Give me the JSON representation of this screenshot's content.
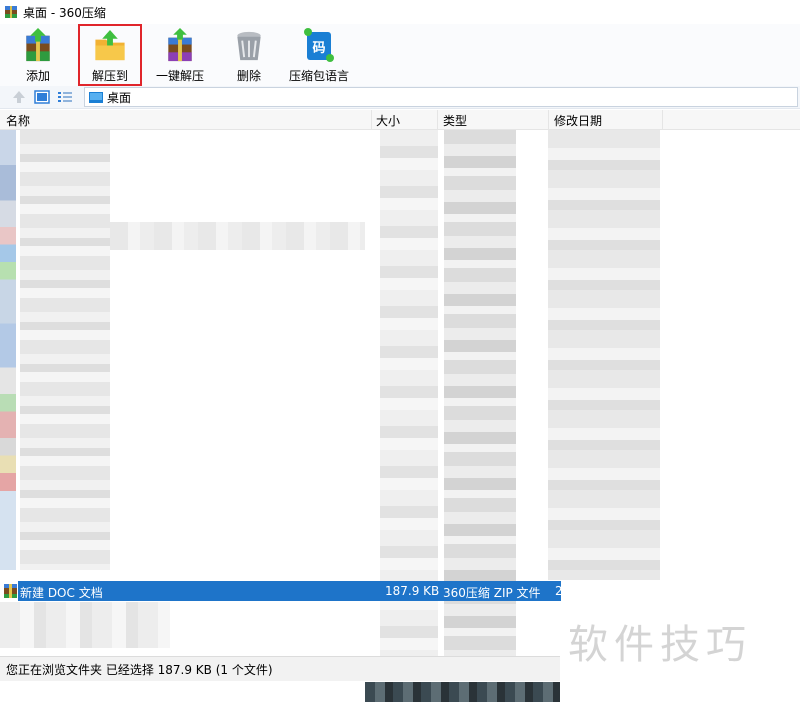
{
  "window": {
    "title": "桌面 - 360压缩"
  },
  "toolbar": {
    "buttons": [
      {
        "label": "添加"
      },
      {
        "label": "解压到"
      },
      {
        "label": "一键解压"
      },
      {
        "label": "删除"
      },
      {
        "label": "压缩包语言"
      }
    ],
    "lang_glyph": "码",
    "highlight_color": "#e0252b"
  },
  "path": {
    "current": "桌面"
  },
  "columns": {
    "name": "名称",
    "size": "大小",
    "type": "类型",
    "modified": "修改日期"
  },
  "selected_file": {
    "name": "新建 DOC 文档",
    "size": "187.9 KB",
    "type": "360压缩 ZIP 文件",
    "extra": "2"
  },
  "status": {
    "text": "您正在浏览文件夹 已经选择 187.9 KB (1 个文件)"
  },
  "watermark": {
    "text": "软件技巧"
  },
  "colors": {
    "selection": "#1e74c9",
    "accent": "#1a7fd4"
  }
}
